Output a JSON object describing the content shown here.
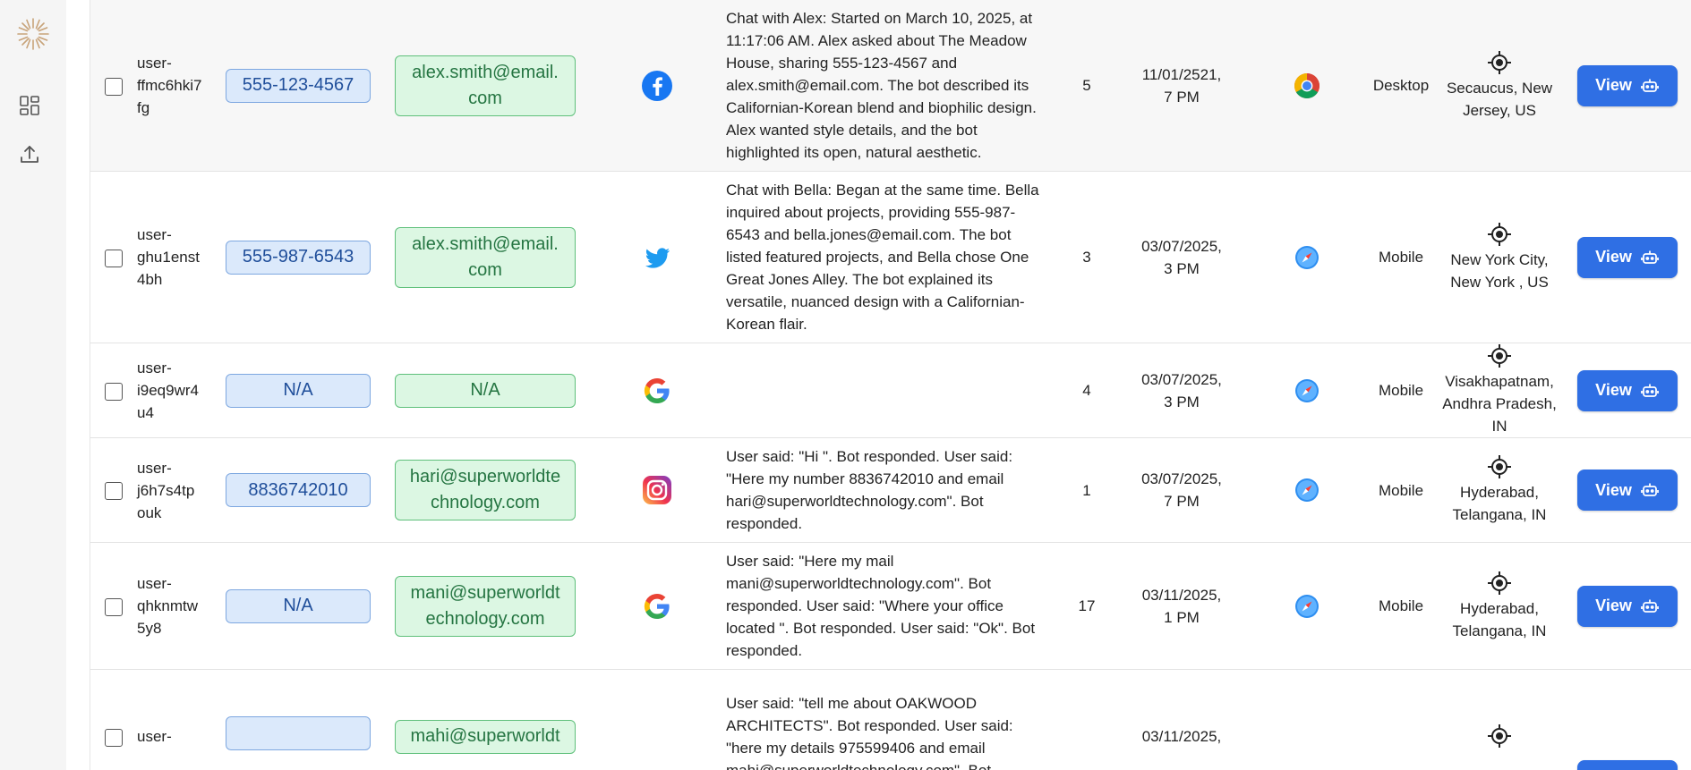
{
  "sidebar": {
    "logo_icon": "sunburst-logo-icon",
    "items": [
      {
        "icon": "dashboard-icon"
      },
      {
        "icon": "upload-icon"
      }
    ]
  },
  "colors": {
    "phone_bg": "#dbe9fb",
    "email_bg": "#dcf7e3",
    "button": "#2f6fe4"
  },
  "table": {
    "view_label": "View",
    "rows": [
      {
        "user": "user-ffmc6hki7fg",
        "user_lines": [
          "user-",
          "ffmc6hki7",
          "fg"
        ],
        "phone": "555-123-4567",
        "email": "alex.smith@email.com",
        "email_lines": [
          "alex.smith@email.",
          "com"
        ],
        "source": "facebook-icon",
        "chat": "Chat with Alex: Started on March 10, 2025, at 11:17:06 AM. Alex asked about The Meadow House, sharing 555-123-4567 and alex.smith@email.com. The bot described its Californian-Korean blend and biophilic design. Alex wanted style details, and the bot highlighted its open, natural aesthetic.",
        "count": "5",
        "date_lines": [
          "11/01/2521,",
          "7 PM"
        ],
        "browser": "chrome-icon",
        "device": "Desktop",
        "location_lines": [
          "Secaucus, New",
          "Jersey, US"
        ]
      },
      {
        "user": "user-ghu1enst4bh",
        "user_lines": [
          "user-",
          "ghu1enst",
          "4bh"
        ],
        "phone": "555-987-6543",
        "email": "alex.smith@email.com",
        "email_lines": [
          "alex.smith@email.",
          "com"
        ],
        "source": "twitter-icon",
        "chat": "Chat with Bella: Began at the same time. Bella inquired about projects, providing 555-987-6543 and bella.jones@email.com. The bot listed featured projects, and Bella chose One Great Jones Alley. The bot explained its versatile, nuanced design with a Californian-Korean flair.",
        "count": "3",
        "date_lines": [
          "03/07/2025,",
          "3 PM"
        ],
        "browser": "safari-icon",
        "device": "Mobile",
        "location_lines": [
          "New York City,",
          "New York , US"
        ]
      },
      {
        "user": "user-i9eq9wr4u4",
        "user_lines": [
          "user-",
          "i9eq9wr4",
          "u4"
        ],
        "phone": "N/A",
        "email": "N/A",
        "email_lines": [
          "N/A"
        ],
        "source": "google-icon",
        "chat": "",
        "count": "4",
        "date_lines": [
          "03/07/2025,",
          "3 PM"
        ],
        "browser": "safari-icon",
        "device": "Mobile",
        "location_lines": [
          "Visakhapatnam,",
          "Andhra Pradesh,",
          "IN"
        ]
      },
      {
        "user": "user-j6h7s4tpouk",
        "user_lines": [
          "user-",
          "j6h7s4tp",
          "ouk"
        ],
        "phone": "8836742010",
        "email": "hari@superworldtechnology.com",
        "email_lines": [
          "hari@superworldte",
          "chnology.com"
        ],
        "source": "instagram-icon",
        "chat": "User said: \"Hi \". Bot responded. User said: \"Here my number 8836742010 and email hari@superworldtechnology.com\". Bot responded.",
        "count": "1",
        "date_lines": [
          "03/07/2025,",
          "7 PM"
        ],
        "browser": "safari-icon",
        "device": "Mobile",
        "location_lines": [
          "Hyderabad,",
          "Telangana, IN"
        ]
      },
      {
        "user": "user-qhknmtw5y8",
        "user_lines": [
          "user-",
          "qhknmtw",
          "5y8"
        ],
        "phone": "N/A",
        "email": "mani@superworldtechnology.com",
        "email_lines": [
          "mani@superworldt",
          "echnology.com"
        ],
        "source": "google-icon",
        "chat": "User said: \"Here my mail mani@superworldtechnology.com\". Bot responded. User said: \"Where your office located \". Bot responded. User said: \"Ok\". Bot responded.",
        "count": "17",
        "date_lines": [
          "03/11/2025,",
          "1 PM"
        ],
        "browser": "safari-icon",
        "device": "Mobile",
        "location_lines": [
          "Hyderabad,",
          "Telangana, IN"
        ]
      },
      {
        "user": "user-",
        "user_lines": [
          "user-"
        ],
        "phone": "",
        "email": "mahi@superworldt",
        "email_lines": [
          "mahi@superworldt"
        ],
        "source": "",
        "chat": "User said: \"tell me about OAKWOOD ARCHITECTS\". Bot responded. User said: \"here my details 975599406 and email mahi@superworldtechnology.com\". Bot",
        "count": "",
        "date_lines": [
          "03/11/2025,"
        ],
        "browser": "",
        "device": "",
        "location_lines": []
      }
    ]
  }
}
